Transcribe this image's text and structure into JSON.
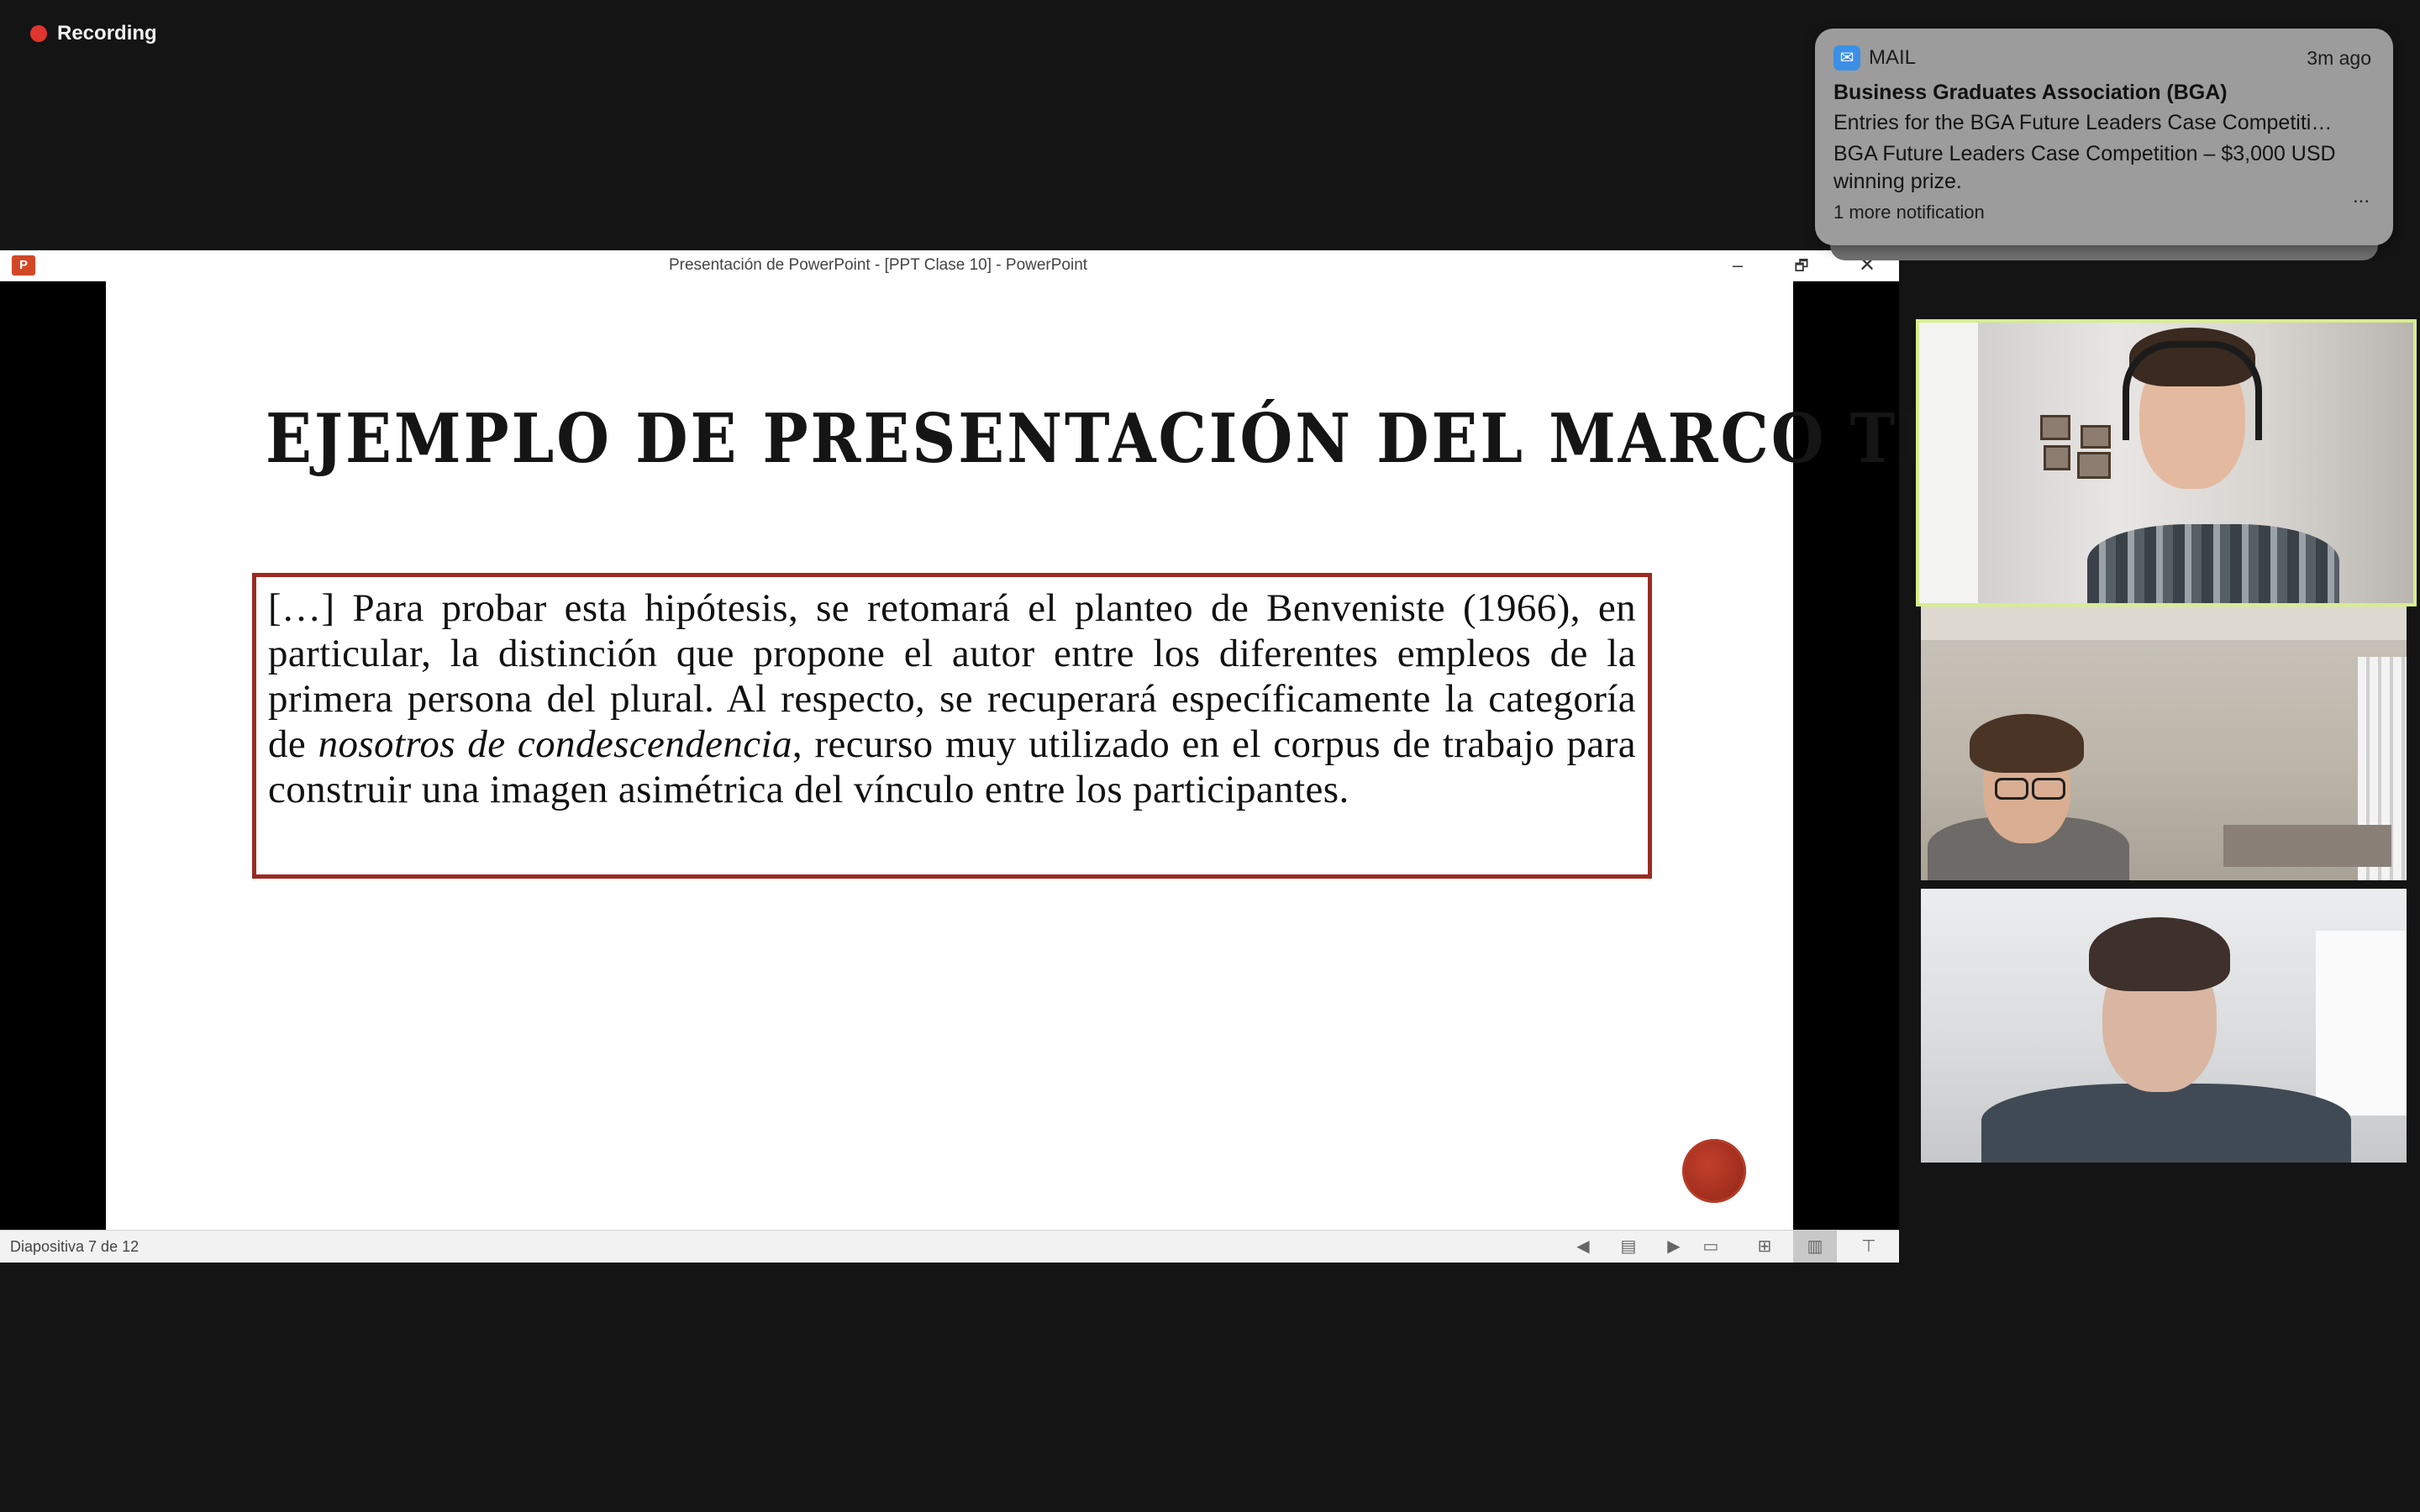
{
  "recording": {
    "label": "Recording",
    "color": "#e0342e"
  },
  "powerpoint": {
    "window_title": "Presentación de PowerPoint - [PPT Clase 10] - PowerPoint",
    "app_icon": "P",
    "window_controls": {
      "minimize": "–",
      "maximize": "🗗",
      "close": "✕"
    },
    "slide": {
      "title": "EJEMPLO DE PRESENTACIÓN DEL MARCO TEÓRICO",
      "quote_before": "[…] Para probar esta hipótesis, se retomará el planteo de Benveniste (1966), en particular, la distinción que propone el autor entre los diferentes empleos de la primera persona del plural. Al respecto, se recuperará específicamente la categoría de ",
      "quote_italic": "nosotros de condescendencia",
      "quote_after": ", recurso muy utilizado en el corpus de trabajo para construir una imagen asimétrica del vínculo entre los participantes.",
      "accent_color": "#9a2a22"
    },
    "status_bar": {
      "slide_counter": "Diapositiva 7 de 12",
      "icons": [
        "prev-slide-icon",
        "notes-icon",
        "next-slide-icon",
        "normal-view-icon",
        "slide-sorter-icon",
        "reading-view-icon",
        "slideshow-icon"
      ]
    }
  },
  "notification": {
    "app": "MAIL",
    "time": "3m ago",
    "sender": "Business Graduates Association (BGA)",
    "subject": "Entries for the BGA Future Leaders Case Competiti…",
    "preview": "BGA Future Leaders Case Competition – $3,000 USD winning prize.",
    "more_dots": "...",
    "more": "1 more notification"
  },
  "participants": [
    {
      "tile": "participant-video-1",
      "active_speaker": true,
      "highlight_color": "#d6ee8a"
    },
    {
      "tile": "participant-video-2",
      "active_speaker": false
    },
    {
      "tile": "participant-video-3",
      "active_speaker": false
    }
  ]
}
